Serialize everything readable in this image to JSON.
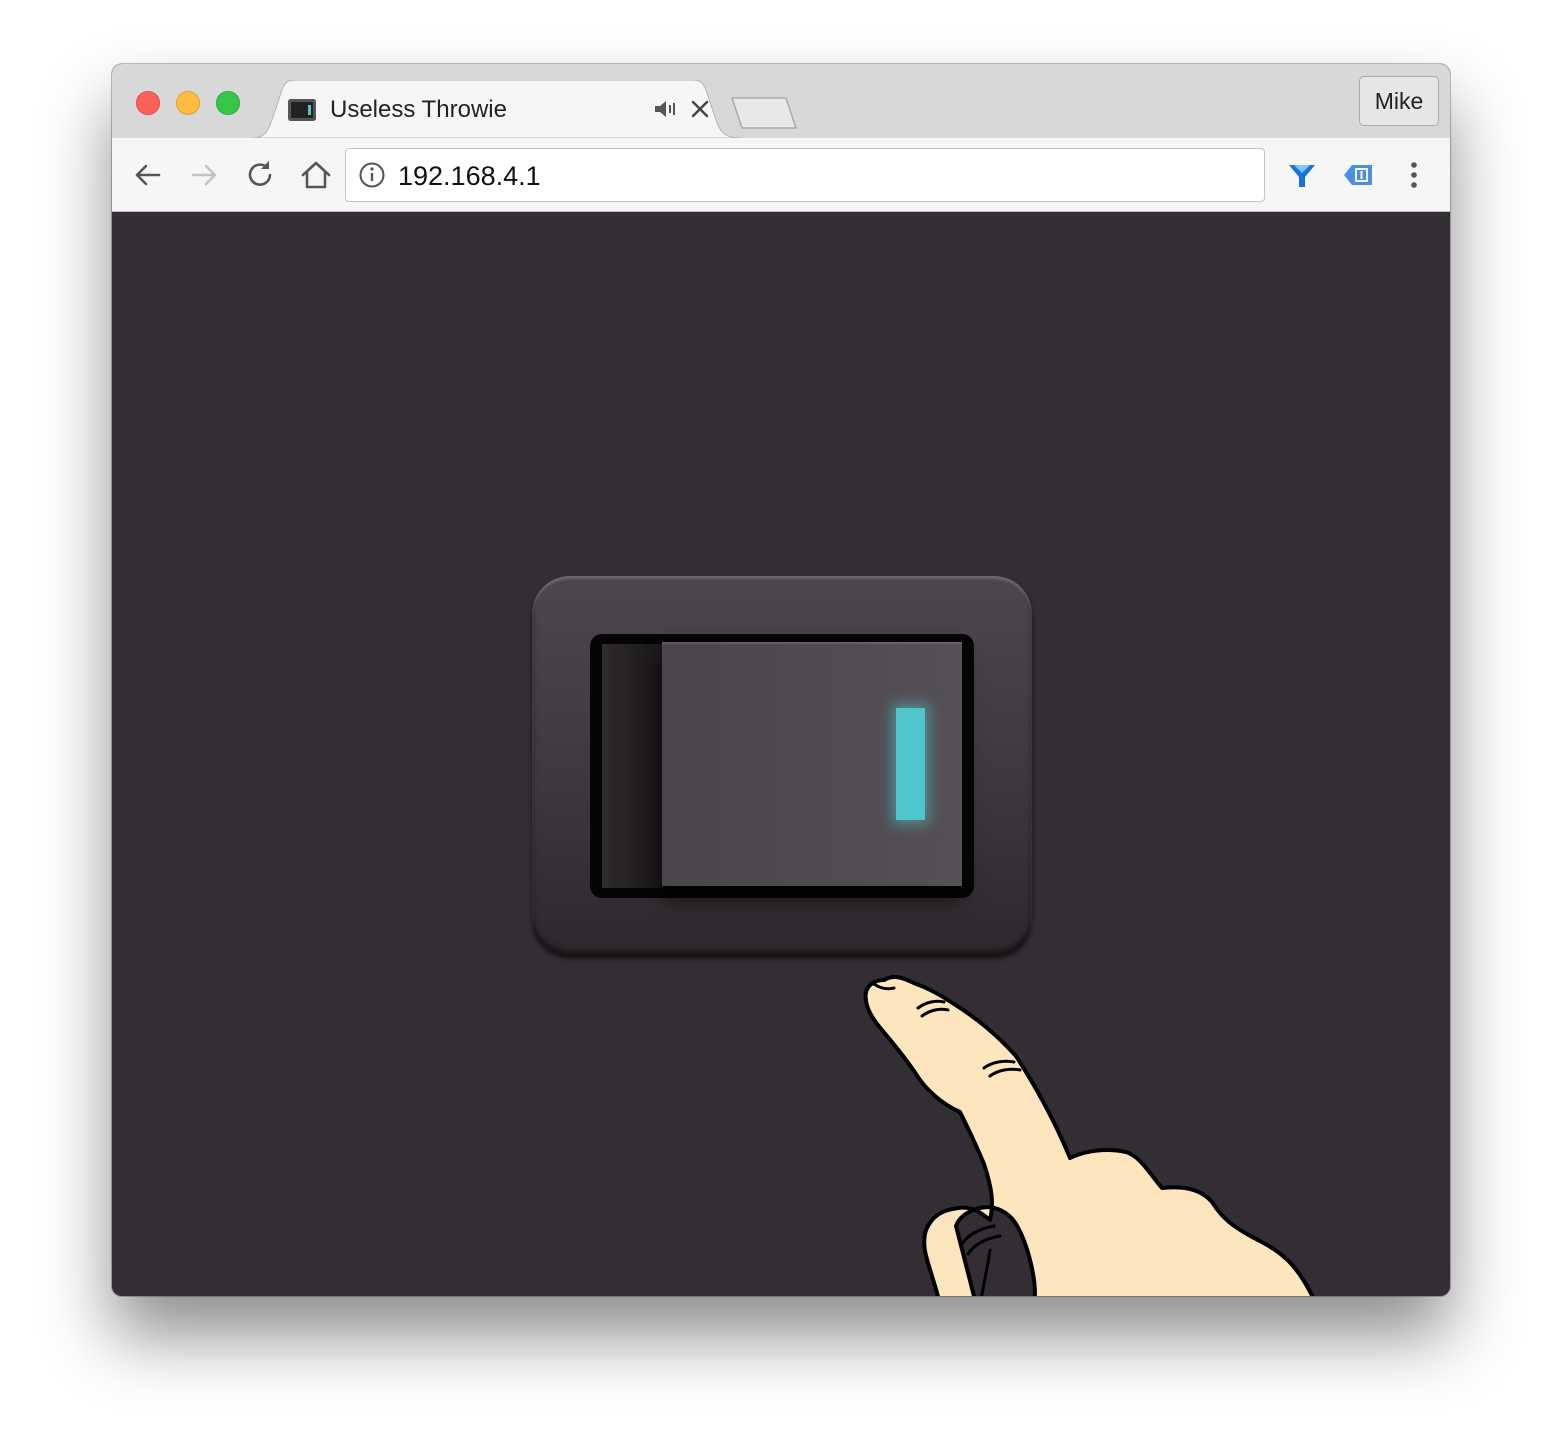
{
  "browser": {
    "tab": {
      "title": "Useless Throwie"
    },
    "profile": {
      "label": "Mike"
    },
    "address_bar": {
      "url": "192.168.4.1"
    },
    "nav_icons": [
      "back-icon",
      "forward-icon",
      "reload-icon",
      "home-icon"
    ],
    "extension_icons": [
      "funnel-extension-icon",
      "tag-extension-icon",
      "menu-icon"
    ]
  },
  "page": {
    "switch": {
      "state": "on",
      "indicator_color": "#4ec6cc"
    },
    "background_color": "#332e33",
    "hand_color": "#fde6bd"
  }
}
